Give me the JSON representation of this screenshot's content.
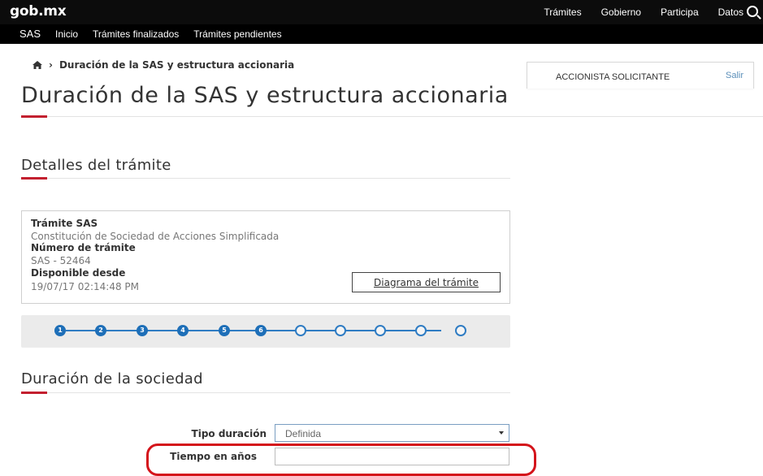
{
  "header": {
    "logo": "gob.mx",
    "nav": [
      "Trámites",
      "Gobierno",
      "Participa",
      "Datos"
    ],
    "subnav": [
      "SAS",
      "Inicio",
      "Trámites finalizados",
      "Trámites pendientes"
    ]
  },
  "breadcrumb": {
    "current": "Duración de la SAS y estructura accionaria"
  },
  "user": {
    "name": "ACCIONISTA SOLICITANTE",
    "logout": "Salir"
  },
  "page": {
    "title": "Duración de la SAS y estructura accionaria"
  },
  "details": {
    "section_title": "Detalles del trámite",
    "tramite_label": "Trámite SAS",
    "tramite_value": "Constitución de Sociedad de Acciones Simplificada",
    "numero_label": "Número de trámite",
    "numero_value": "SAS - 52464",
    "disponible_label": "Disponible desde",
    "disponible_value": "19/07/17 02:14:48 PM",
    "diagram_button": "Diagrama del trámite"
  },
  "stepper": {
    "completed": [
      "1",
      "2",
      "3",
      "4",
      "5",
      "6"
    ],
    "total": 11,
    "active_color": "#1e6fb8"
  },
  "form": {
    "section_title": "Duración de la sociedad",
    "tipo_label": "Tipo duración",
    "tipo_value": "Definida",
    "tiempo_label": "Tiempo en años",
    "tiempo_value": ""
  },
  "colors": {
    "accent_red": "#c3202f",
    "highlight_red": "#d4141b",
    "step_blue": "#1e6fb8"
  }
}
